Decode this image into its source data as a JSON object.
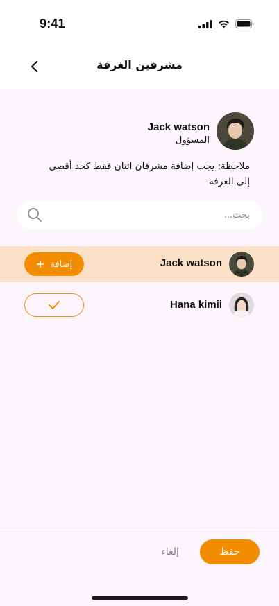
{
  "status_bar": {
    "time": "9:41"
  },
  "header": {
    "title": "مشرفين الغرفة"
  },
  "admin": {
    "name": "Jack watson",
    "role": "المسؤول"
  },
  "note": {
    "text": "ملاحظة: يجب إضافة مشرفان اثنان فقط كحد أقصى إلى الغرفة"
  },
  "search": {
    "placeholder": "بحث..."
  },
  "users": [
    {
      "name": "Jack watson",
      "action_label": "إضافة",
      "action_icon": "plus-icon",
      "highlighted": true
    },
    {
      "name": "Hana kimii",
      "action_icon": "check-icon",
      "highlighted": false
    }
  ],
  "footer": {
    "save_label": "حفظ",
    "cancel_label": "إلغاء"
  },
  "colors": {
    "accent": "#f28c00",
    "highlight_row": "#fbe0c8",
    "background": "#fdf5fc"
  }
}
